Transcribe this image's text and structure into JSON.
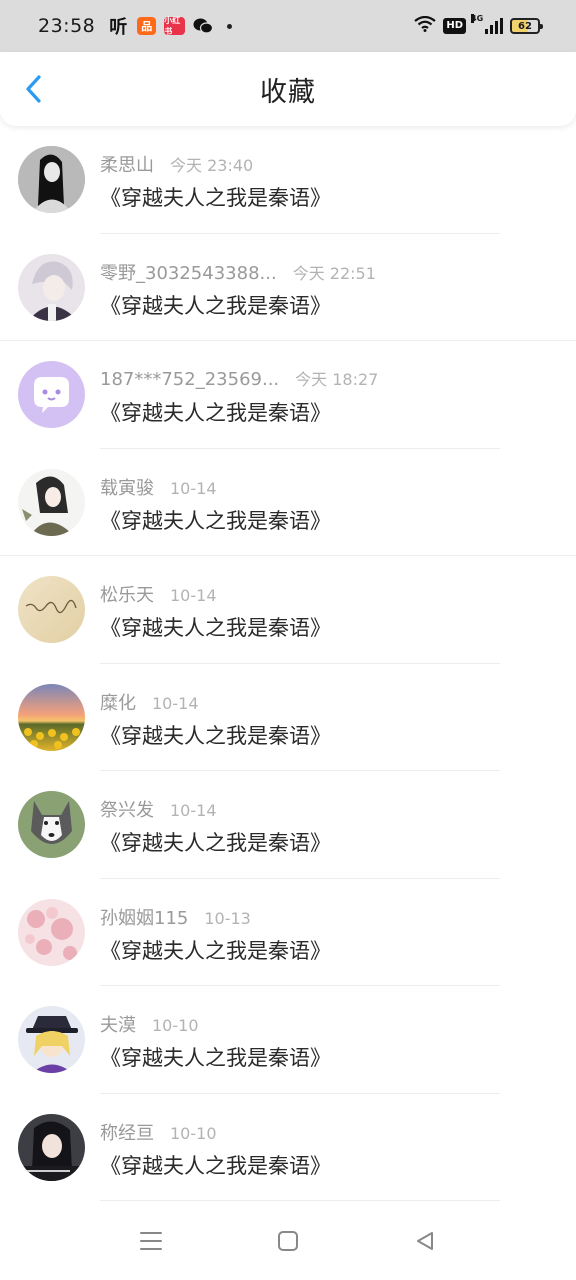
{
  "status_bar": {
    "time": "23:58",
    "app_ting_label": "听",
    "app_orange_label": "品",
    "app_red_label": "小红书",
    "wechat_label": "●●",
    "hd_label": "HD",
    "network_label": "4G",
    "battery": "62"
  },
  "header": {
    "title": "收藏",
    "back_icon": "chevron-left-icon",
    "accent_color": "#2a9af3"
  },
  "items": [
    {
      "name": "柔思山",
      "time": "今天 23:40",
      "book": "《穿越夫人之我是秦语》"
    },
    {
      "name": "零野_3032543388...",
      "time": "今天 22:51",
      "book": "《穿越夫人之我是秦语》"
    },
    {
      "name": "187***752_23569...",
      "time": "今天 18:27",
      "book": "《穿越夫人之我是秦语》"
    },
    {
      "name": "载寅骏",
      "time": "10-14",
      "book": "《穿越夫人之我是秦语》"
    },
    {
      "name": "松乐天",
      "time": "10-14",
      "book": "《穿越夫人之我是秦语》"
    },
    {
      "name": "糜化",
      "time": "10-14",
      "book": "《穿越夫人之我是秦语》"
    },
    {
      "name": "祭兴发",
      "time": "10-14",
      "book": "《穿越夫人之我是秦语》"
    },
    {
      "name": "孙姻姻115",
      "time": "10-13",
      "book": "《穿越夫人之我是秦语》"
    },
    {
      "name": "夫漠",
      "time": "10-10",
      "book": "《穿越夫人之我是秦语》"
    },
    {
      "name": "称经亘",
      "time": "10-10",
      "book": "《穿越夫人之我是秦语》"
    }
  ],
  "nav": {
    "menu_icon": "menu-icon",
    "home_icon": "home-square-icon",
    "back_icon": "back-triangle-icon"
  }
}
